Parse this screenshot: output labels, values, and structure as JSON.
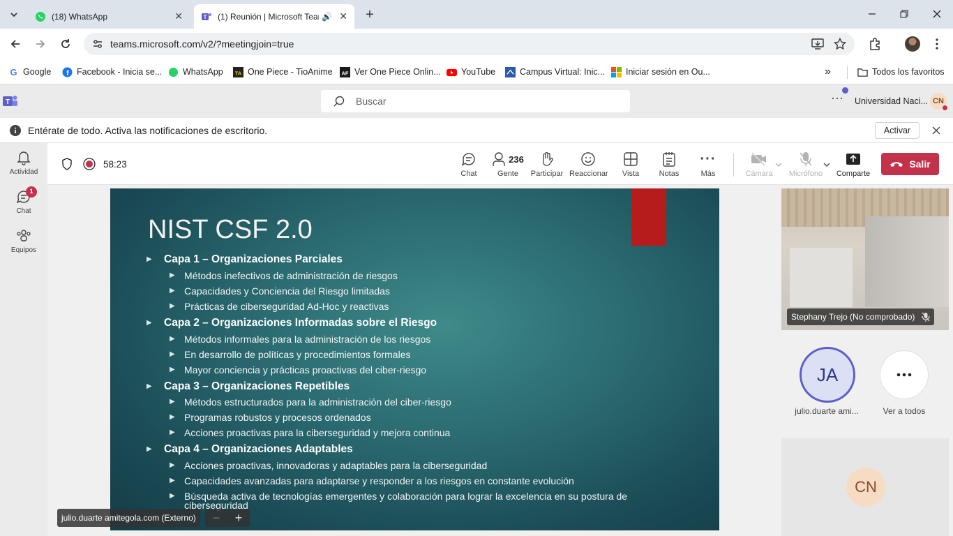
{
  "browser": {
    "tabs": [
      {
        "title": "(18) WhatsApp"
      },
      {
        "title": "(1) Reunión | Microsoft Tean"
      }
    ],
    "url": "teams.microsoft.com/v2/?meetingjoin=true",
    "bookmarks": [
      "Google",
      "Facebook - Inicia se...",
      "WhatsApp",
      "One Piece - TioAnime",
      "Ver One Piece Onlin...",
      "YouTube",
      "Campus Virtual: Inic...",
      "Iniciar sesión en Ou..."
    ],
    "all_favorites": "Todos los favoritos"
  },
  "teams": {
    "search_placeholder": "Buscar",
    "org": "Universidad Naci...",
    "user_initials": "CN",
    "notification": "Entérate de todo. Activa las notificaciones de escritorio.",
    "activate": "Activar",
    "rail": [
      {
        "label": "Actividad"
      },
      {
        "label": "Chat",
        "badge": "1"
      },
      {
        "label": "Equipos"
      }
    ]
  },
  "meeting": {
    "timer": "58:23",
    "people_count": "236",
    "toolbar": {
      "chat": "Chat",
      "people": "Gente",
      "raise": "Participar",
      "react": "Reaccionar",
      "view": "Vista",
      "notes": "Notas",
      "more": "Más",
      "camera": "Cámara",
      "mic": "Micrófono",
      "share": "Comparte",
      "leave": "Salir"
    },
    "presenter_label": "julio.duarte amitegola.com (Externo)",
    "video_name": "Stephany Trejo (No comprobado)",
    "participants": [
      {
        "initials": "JA",
        "name": "julio.duarte ami..."
      },
      {
        "initials": "",
        "name": "Ver a todos"
      }
    ],
    "tile_initials": "CN"
  },
  "slide": {
    "title": "NIST CSF 2.0",
    "layers": [
      {
        "heading": "Capa 1 – Organizaciones Parciales",
        "items": [
          "Métodos inefectivos de administración de riesgos",
          "Capacidades y Conciencia del Riesgo limitadas",
          "Prácticas de ciberseguridad Ad-Hoc y reactivas"
        ]
      },
      {
        "heading": "Capa 2 – Organizaciones Informadas sobre el Riesgo",
        "items": [
          "Métodos informales para la administración de los riesgos",
          "En desarrollo de políticas y procedimientos formales",
          "Mayor conciencia y prácticas proactivas del ciber-riesgo"
        ]
      },
      {
        "heading": "Capa 3 – Organizaciones Repetibles",
        "items": [
          "Métodos estructurados para la administración del ciber-riesgo",
          "Programas robustos y procesos ordenados",
          "Acciones proactivas para la ciberseguridad y mejora continua"
        ]
      },
      {
        "heading": "Capa 4 – Organizaciones Adaptables",
        "items": [
          "Acciones proactivas, innovadoras y adaptables para la ciberseguridad",
          "Capacidades avanzadas para adaptarse y responder a los riesgos en constante evolución",
          "Búsqueda activa de tecnologías emergentes y colaboración  para lograr la excelencia en su postura de ciberseguridad"
        ]
      }
    ]
  }
}
